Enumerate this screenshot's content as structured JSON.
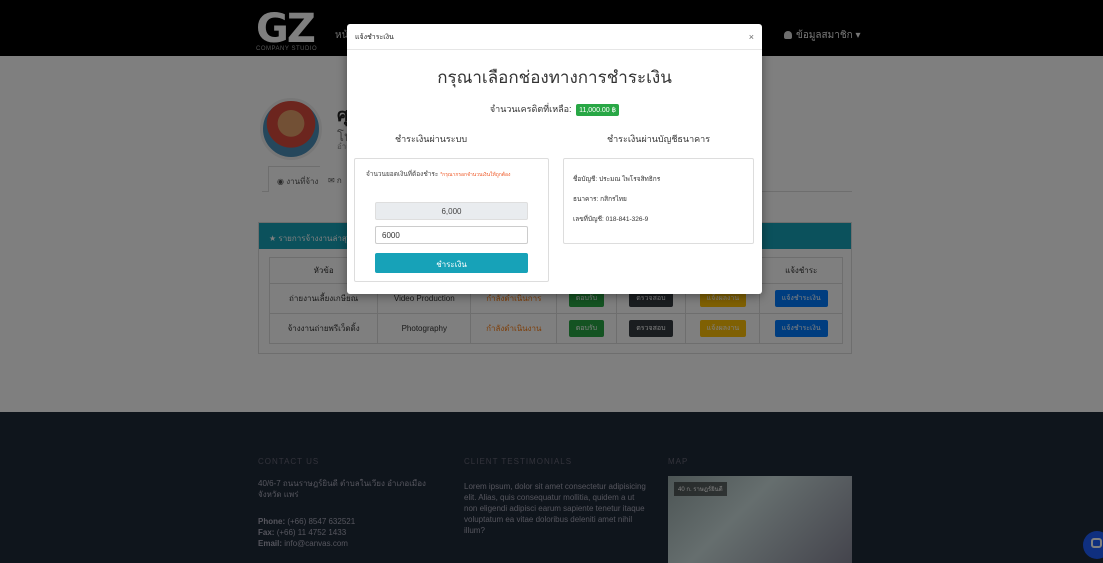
{
  "topbar": {
    "logo": "GZ",
    "logo_sub": "COMPANY STUDIO",
    "nav_home": "หน้",
    "user_menu": "ข้อมูลสมาชิก ▾"
  },
  "profile": {
    "name": "ศุ",
    "line1": "โป",
    "line2": "อำเ"
  },
  "tabs": [
    {
      "label": "◉ งานที่จ้าง"
    },
    {
      "label": "✉ ก"
    }
  ],
  "jobs_panel": {
    "heading": "★ รายการจ้างงานล่าสุด",
    "columns": [
      "หัวข้อ",
      "",
      "",
      "",
      "",
      "",
      "แจ้งชำระ"
    ],
    "rows": [
      {
        "title": "ถ่ายงานเลี้ยงเกษียณ",
        "category": "Video Production",
        "status": "กำลังดำเนินการ",
        "accept": "ตอบรับ",
        "review": "ตรวจสอบ",
        "finish": "แจ้งผลงาน",
        "pay": "แจ้งชำระเงิน"
      },
      {
        "title": "จ้างงานถ่ายพรีเว็ดดิ้ง",
        "category": "Photography",
        "status": "กำลังดำเนินงาน",
        "accept": "ตอบรับ",
        "review": "ตรวจสอบ",
        "finish": "แจ้งผลงาน",
        "pay": "แจ้งชำระเงิน"
      }
    ]
  },
  "footer": {
    "contact_heading": "CONTACT US",
    "address": "40/6-7 ถนนราษฎร์ยินดี ตำบลในเวียง อำเภอเมือง จังหวัด แพร่",
    "phone_label": "Phone:",
    "phone": "(+66) 8547 632521",
    "fax_label": "Fax:",
    "fax": "(+66) 11 4752 1433",
    "email_label": "Email:",
    "email": "info@canvas.com",
    "testimonials_heading": "CLIENT TESTIMONIALS",
    "testimonial": "Lorem ipsum, dolor sit amet consectetur adipisicing elit. Alias, quis consequatur mollitia, quidem a ut non eligendi adipisci earum sapiente tenetur itaque voluptatum ea vitae doloribus deleniti amet nihil illum?",
    "map_heading": "MAP",
    "map_label": "40 ก. ราษฎร์ยินดี"
  },
  "modal": {
    "header": "แจ้งชำระเงิน",
    "close": "×",
    "title": "กรุณาเลือกช่องทางการชำระเงิน",
    "credit_label": "จำนวนเครดิตที่เหลือ:",
    "credit_value": "11,000.00 ฿",
    "system_title": "ชำระเงินผ่านระบบ",
    "bank_title": "ชำระเงินผ่านบัญชีธนาคาร",
    "amount_label": "จำนวนยอดเงินที่ต้องชำระ",
    "amount_note": "*กรุณากรอกจำนวนเงินให้ถูกต้อง",
    "amount_display": "6,000",
    "amount_input": "6000",
    "pay_button": "ชำระเงิน",
    "account_name": "ชื่อบัญชี: ประมณ ไพโรจสิทธิกร",
    "bank_name": "ธนาคาร: กสิกรไทย",
    "account_number": "เลขที่บัญชี: 018-841-326-9"
  }
}
